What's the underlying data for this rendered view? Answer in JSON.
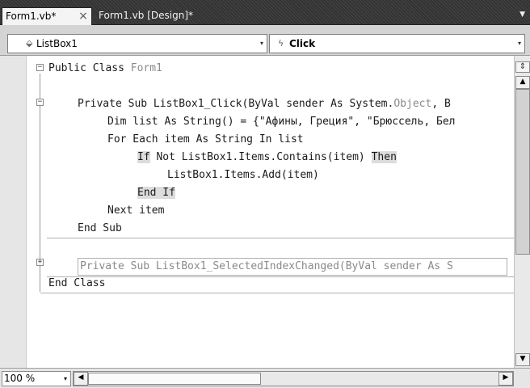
{
  "tabs": {
    "active": "Form1.vb*",
    "close_glyph": "×",
    "inactive": "Form1.vb [Design]*",
    "dropdown_glyph": "▼"
  },
  "toolbar": {
    "object_combo": "ListBox1",
    "event_combo": "Click",
    "combo_arrow": "▾"
  },
  "code": {
    "line1_kw": "Public Class",
    "line1_name": "Form1",
    "line2_pre": "Private Sub ListBox1_Click(ByVal sender As System.",
    "line2_type": "Object",
    "line2_post": ", B",
    "line3": "Dim list As String() = {\"Афины, Греция\", \"Брюссель, Бел",
    "line4": "For Each item As String In list",
    "line5_if": "If",
    "line5_mid": " Not ListBox1.Items.Contains(item) ",
    "line5_then": "Then",
    "line6": "ListBox1.Items.Add(item)",
    "line7": "End If",
    "line8": "Next item",
    "line9": "End Sub",
    "collapsed": "Private Sub ListBox1_SelectedIndexChanged(ByVal sender As S",
    "end_class": "End Class"
  },
  "fold": {
    "minus": "−",
    "plus": "+"
  },
  "scroll": {
    "splitter_glyph": "⇕",
    "up_glyph": "▲",
    "down_glyph": "▼",
    "left_glyph": "◀",
    "right_glyph": "▶"
  },
  "status": {
    "zoom": "100 %",
    "zoom_arrow": "▾"
  }
}
